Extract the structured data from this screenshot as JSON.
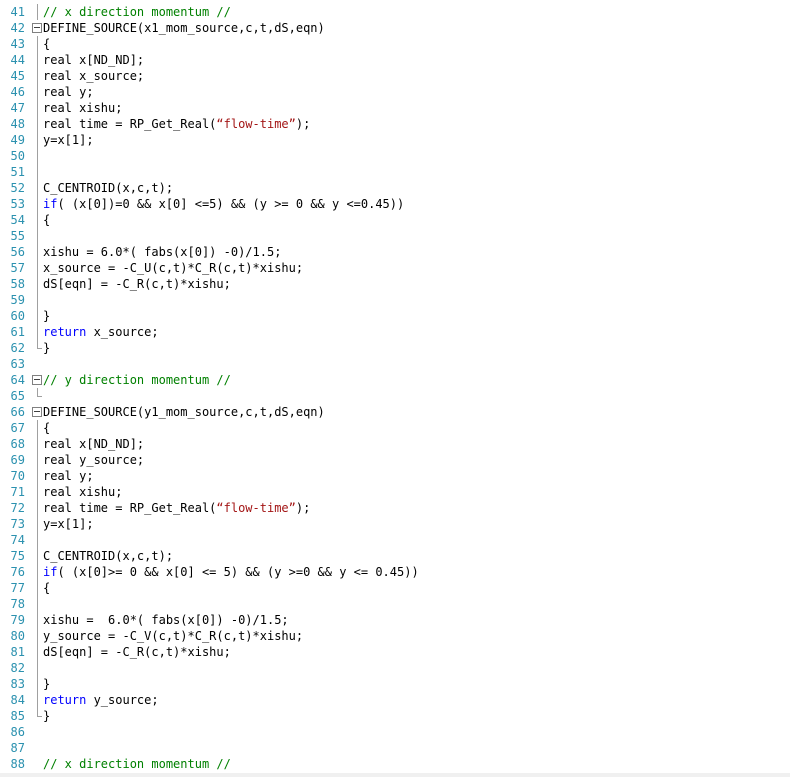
{
  "editor": {
    "lines": [
      {
        "num": "41",
        "fold": "none",
        "guide": "top",
        "tokens": [
          {
            "t": "// x direction momentum //",
            "c": "comment"
          }
        ]
      },
      {
        "num": "42",
        "fold": "box",
        "guide": "none",
        "tokens": [
          {
            "t": "DEFINE_SOURCE(x1_mom_source,c,t,dS,eqn)",
            "c": "plain"
          }
        ]
      },
      {
        "num": "43",
        "fold": "none",
        "guide": "line",
        "tokens": [
          {
            "t": "{",
            "c": "plain"
          }
        ]
      },
      {
        "num": "44",
        "fold": "none",
        "guide": "line",
        "tokens": [
          {
            "t": "real x[ND_ND];",
            "c": "plain"
          }
        ]
      },
      {
        "num": "45",
        "fold": "none",
        "guide": "line",
        "tokens": [
          {
            "t": "real x_source;",
            "c": "plain"
          }
        ]
      },
      {
        "num": "46",
        "fold": "none",
        "guide": "line",
        "tokens": [
          {
            "t": "real y;",
            "c": "plain"
          }
        ]
      },
      {
        "num": "47",
        "fold": "none",
        "guide": "line",
        "tokens": [
          {
            "t": "real xishu;",
            "c": "plain"
          }
        ]
      },
      {
        "num": "48",
        "fold": "none",
        "guide": "line",
        "tokens": [
          {
            "t": "real time = RP_Get_Real(",
            "c": "plain"
          },
          {
            "t": "“flow-time”",
            "c": "string"
          },
          {
            "t": ");",
            "c": "plain"
          }
        ]
      },
      {
        "num": "49",
        "fold": "none",
        "guide": "line",
        "tokens": [
          {
            "t": "y=x[1];",
            "c": "plain"
          }
        ]
      },
      {
        "num": "50",
        "fold": "none",
        "guide": "line",
        "tokens": []
      },
      {
        "num": "51",
        "fold": "none",
        "guide": "line",
        "tokens": []
      },
      {
        "num": "52",
        "fold": "none",
        "guide": "line",
        "tokens": [
          {
            "t": "C_CENTROID(x,c,t);",
            "c": "plain"
          }
        ]
      },
      {
        "num": "53",
        "fold": "none",
        "guide": "line",
        "tokens": [
          {
            "t": "if",
            "c": "keyword"
          },
          {
            "t": "( (x[0])=0 && x[0] <=5) && (y >= 0 && y <=0.45))",
            "c": "plain"
          }
        ]
      },
      {
        "num": "54",
        "fold": "none",
        "guide": "line",
        "tokens": [
          {
            "t": "{",
            "c": "plain"
          }
        ]
      },
      {
        "num": "55",
        "fold": "none",
        "guide": "line",
        "tokens": []
      },
      {
        "num": "56",
        "fold": "none",
        "guide": "line",
        "tokens": [
          {
            "t": "xishu = 6.0*( fabs(x[0]) -0)/1.5;",
            "c": "plain"
          }
        ]
      },
      {
        "num": "57",
        "fold": "none",
        "guide": "line",
        "tokens": [
          {
            "t": "x_source = -C_U(c,t)*C_R(c,t)*xishu;",
            "c": "plain"
          }
        ]
      },
      {
        "num": "58",
        "fold": "none",
        "guide": "line",
        "tokens": [
          {
            "t": "dS[eqn] = -C_R(c,t)*xishu;",
            "c": "plain"
          }
        ]
      },
      {
        "num": "59",
        "fold": "none",
        "guide": "line",
        "tokens": []
      },
      {
        "num": "60",
        "fold": "none",
        "guide": "line",
        "tokens": [
          {
            "t": "}",
            "c": "plain"
          }
        ]
      },
      {
        "num": "61",
        "fold": "none",
        "guide": "line",
        "tokens": [
          {
            "t": "return",
            "c": "keyword"
          },
          {
            "t": " x_source;",
            "c": "plain"
          }
        ]
      },
      {
        "num": "62",
        "fold": "none",
        "guide": "end",
        "tokens": [
          {
            "t": "}",
            "c": "plain"
          }
        ]
      },
      {
        "num": "63",
        "fold": "none",
        "guide": "none",
        "tokens": []
      },
      {
        "num": "64",
        "fold": "box",
        "guide": "none",
        "tokens": [
          {
            "t": "// y direction momentum //",
            "c": "comment"
          }
        ]
      },
      {
        "num": "65",
        "fold": "none",
        "guide": "end",
        "tokens": []
      },
      {
        "num": "66",
        "fold": "box",
        "guide": "none",
        "tokens": [
          {
            "t": "DEFINE_SOURCE(y1_mom_source,c,t,dS,eqn)",
            "c": "plain"
          }
        ]
      },
      {
        "num": "67",
        "fold": "none",
        "guide": "line",
        "tokens": [
          {
            "t": "{",
            "c": "plain"
          }
        ]
      },
      {
        "num": "68",
        "fold": "none",
        "guide": "line",
        "tokens": [
          {
            "t": "real x[ND_ND];",
            "c": "plain"
          }
        ]
      },
      {
        "num": "69",
        "fold": "none",
        "guide": "line",
        "tokens": [
          {
            "t": "real y_source;",
            "c": "plain"
          }
        ]
      },
      {
        "num": "70",
        "fold": "none",
        "guide": "line",
        "tokens": [
          {
            "t": "real y;",
            "c": "plain"
          }
        ]
      },
      {
        "num": "71",
        "fold": "none",
        "guide": "line",
        "tokens": [
          {
            "t": "real xishu;",
            "c": "plain"
          }
        ]
      },
      {
        "num": "72",
        "fold": "none",
        "guide": "line",
        "tokens": [
          {
            "t": "real time = RP_Get_Real(",
            "c": "plain"
          },
          {
            "t": "“flow-time”",
            "c": "string"
          },
          {
            "t": ");",
            "c": "plain"
          }
        ]
      },
      {
        "num": "73",
        "fold": "none",
        "guide": "line",
        "tokens": [
          {
            "t": "y=x[1];",
            "c": "plain"
          }
        ]
      },
      {
        "num": "74",
        "fold": "none",
        "guide": "line",
        "tokens": []
      },
      {
        "num": "75",
        "fold": "none",
        "guide": "line",
        "tokens": [
          {
            "t": "C_CENTROID(x,c,t);",
            "c": "plain"
          }
        ]
      },
      {
        "num": "76",
        "fold": "none",
        "guide": "line",
        "tokens": [
          {
            "t": "if",
            "c": "keyword"
          },
          {
            "t": "( (x[0]>= 0 && x[0] <= 5) && (y >=0 && y <= 0.45))",
            "c": "plain"
          }
        ]
      },
      {
        "num": "77",
        "fold": "none",
        "guide": "line",
        "tokens": [
          {
            "t": "{",
            "c": "plain"
          }
        ]
      },
      {
        "num": "78",
        "fold": "none",
        "guide": "line",
        "tokens": []
      },
      {
        "num": "79",
        "fold": "none",
        "guide": "line",
        "tokens": [
          {
            "t": "xishu =  6.0*( fabs(x[0]) -0)/1.5;",
            "c": "plain"
          }
        ]
      },
      {
        "num": "80",
        "fold": "none",
        "guide": "line",
        "tokens": [
          {
            "t": "y_source = -C_V(c,t)*C_R(c,t)*xishu;",
            "c": "plain"
          }
        ]
      },
      {
        "num": "81",
        "fold": "none",
        "guide": "line",
        "tokens": [
          {
            "t": "dS[eqn] = -C_R(c,t)*xishu;",
            "c": "plain"
          }
        ]
      },
      {
        "num": "82",
        "fold": "none",
        "guide": "line",
        "tokens": []
      },
      {
        "num": "83",
        "fold": "none",
        "guide": "line",
        "tokens": [
          {
            "t": "}",
            "c": "plain"
          }
        ]
      },
      {
        "num": "84",
        "fold": "none",
        "guide": "line",
        "tokens": [
          {
            "t": "return",
            "c": "keyword"
          },
          {
            "t": " y_source;",
            "c": "plain"
          }
        ]
      },
      {
        "num": "85",
        "fold": "none",
        "guide": "end",
        "tokens": [
          {
            "t": "}",
            "c": "plain"
          }
        ]
      },
      {
        "num": "86",
        "fold": "none",
        "guide": "none",
        "tokens": []
      },
      {
        "num": "87",
        "fold": "none",
        "guide": "none",
        "tokens": []
      },
      {
        "num": "88",
        "fold": "none",
        "guide": "none",
        "tokens": [
          {
            "t": "// x direction momentum //",
            "c": "comment"
          }
        ]
      }
    ]
  },
  "colors": {
    "line_number": "#2b91af",
    "comment": "#008000",
    "keyword": "#0000ff",
    "string": "#a31515",
    "text": "#000000"
  }
}
